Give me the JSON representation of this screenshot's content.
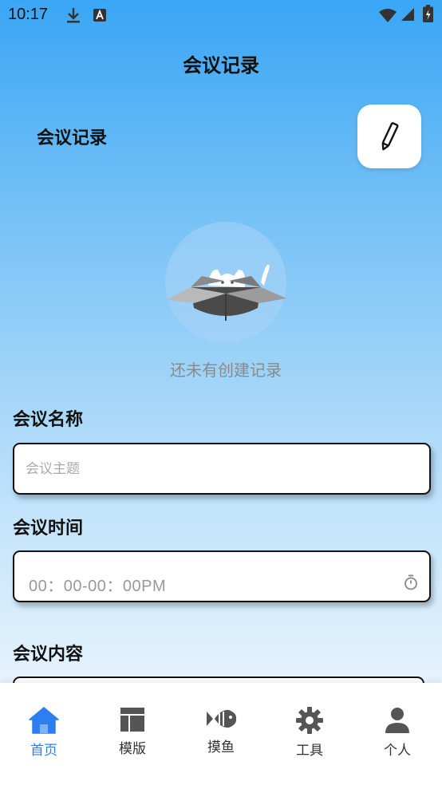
{
  "status_bar": {
    "time": "10:17"
  },
  "header": {
    "title": "会议记录"
  },
  "section": {
    "title": "会议记录"
  },
  "empty_state": {
    "message": "还未有创建记录"
  },
  "form": {
    "name_label": "会议名称",
    "name_placeholder": "会议主题",
    "time_label": "会议时间",
    "time_value": "00：00-00：00PM",
    "content_label": "会议内容"
  },
  "nav": {
    "items": [
      {
        "label": "首页",
        "icon": "home-icon",
        "active": true
      },
      {
        "label": "模版",
        "icon": "template-icon",
        "active": false
      },
      {
        "label": "摸鱼",
        "icon": "fish-icon",
        "active": false
      },
      {
        "label": "工具",
        "icon": "gear-icon",
        "active": false
      },
      {
        "label": "个人",
        "icon": "person-icon",
        "active": false
      }
    ]
  },
  "colors": {
    "accent": "#2d7ff0",
    "icon_gray": "#555555"
  }
}
